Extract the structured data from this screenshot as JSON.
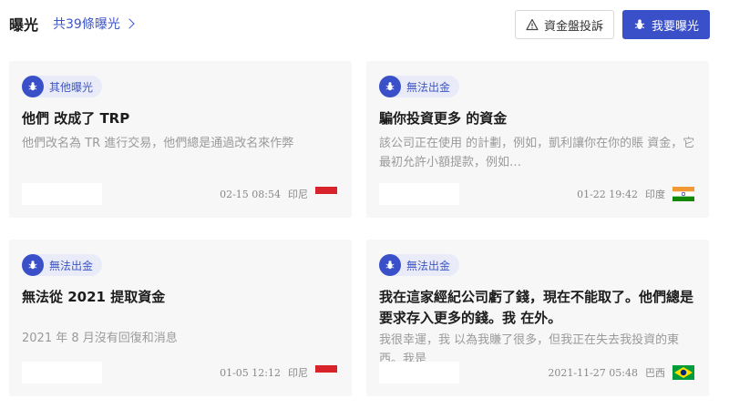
{
  "header": {
    "title": "曝光",
    "count_link": "共39條曝光",
    "complain_button": "資金盤投訴",
    "expose_button": "我要曝光"
  },
  "cards": [
    {
      "badge": "其他曝光",
      "title": "他們 改成了 TRP",
      "desc": "他們改名為 TR 進行交易，他們總是通過改名來作弊",
      "time": "02-15 08:54",
      "country": "印尼",
      "flag": "indonesia"
    },
    {
      "badge": "無法出金",
      "title": "騙你投資更多 的資金",
      "desc": "該公司正在使用 的計劃，例如，凱利讓你在你的賬 資金，它最初允許小額提款，例如…",
      "time": "01-22 19:42",
      "country": "印度",
      "flag": "india"
    },
    {
      "badge": "無法出金",
      "title": "無法從 2021 提取資金",
      "desc": "2021 年 8 月沒有回復和消息",
      "time": "01-05 12:12",
      "country": "印尼",
      "flag": "indonesia"
    },
    {
      "badge": "無法出金",
      "title": "我在這家經紀公司虧了錢，現在不能取了。他們總是要求存入更多的錢。我 在外。",
      "desc": "我很幸運，我 以為我賺了很多，但我正在失去我投資的東西。我是",
      "time": "2021-11-27 05:48",
      "country": "巴西",
      "flag": "brazil"
    }
  ],
  "colors": {
    "accent": "#3a50c9",
    "badge_bg": "#e9ecf8",
    "card_bg": "#f7f7f8"
  },
  "icons": {
    "count_link": "chevron-right-icon",
    "complain_button": "warning-triangle-icon",
    "badge": "bug-icon"
  }
}
